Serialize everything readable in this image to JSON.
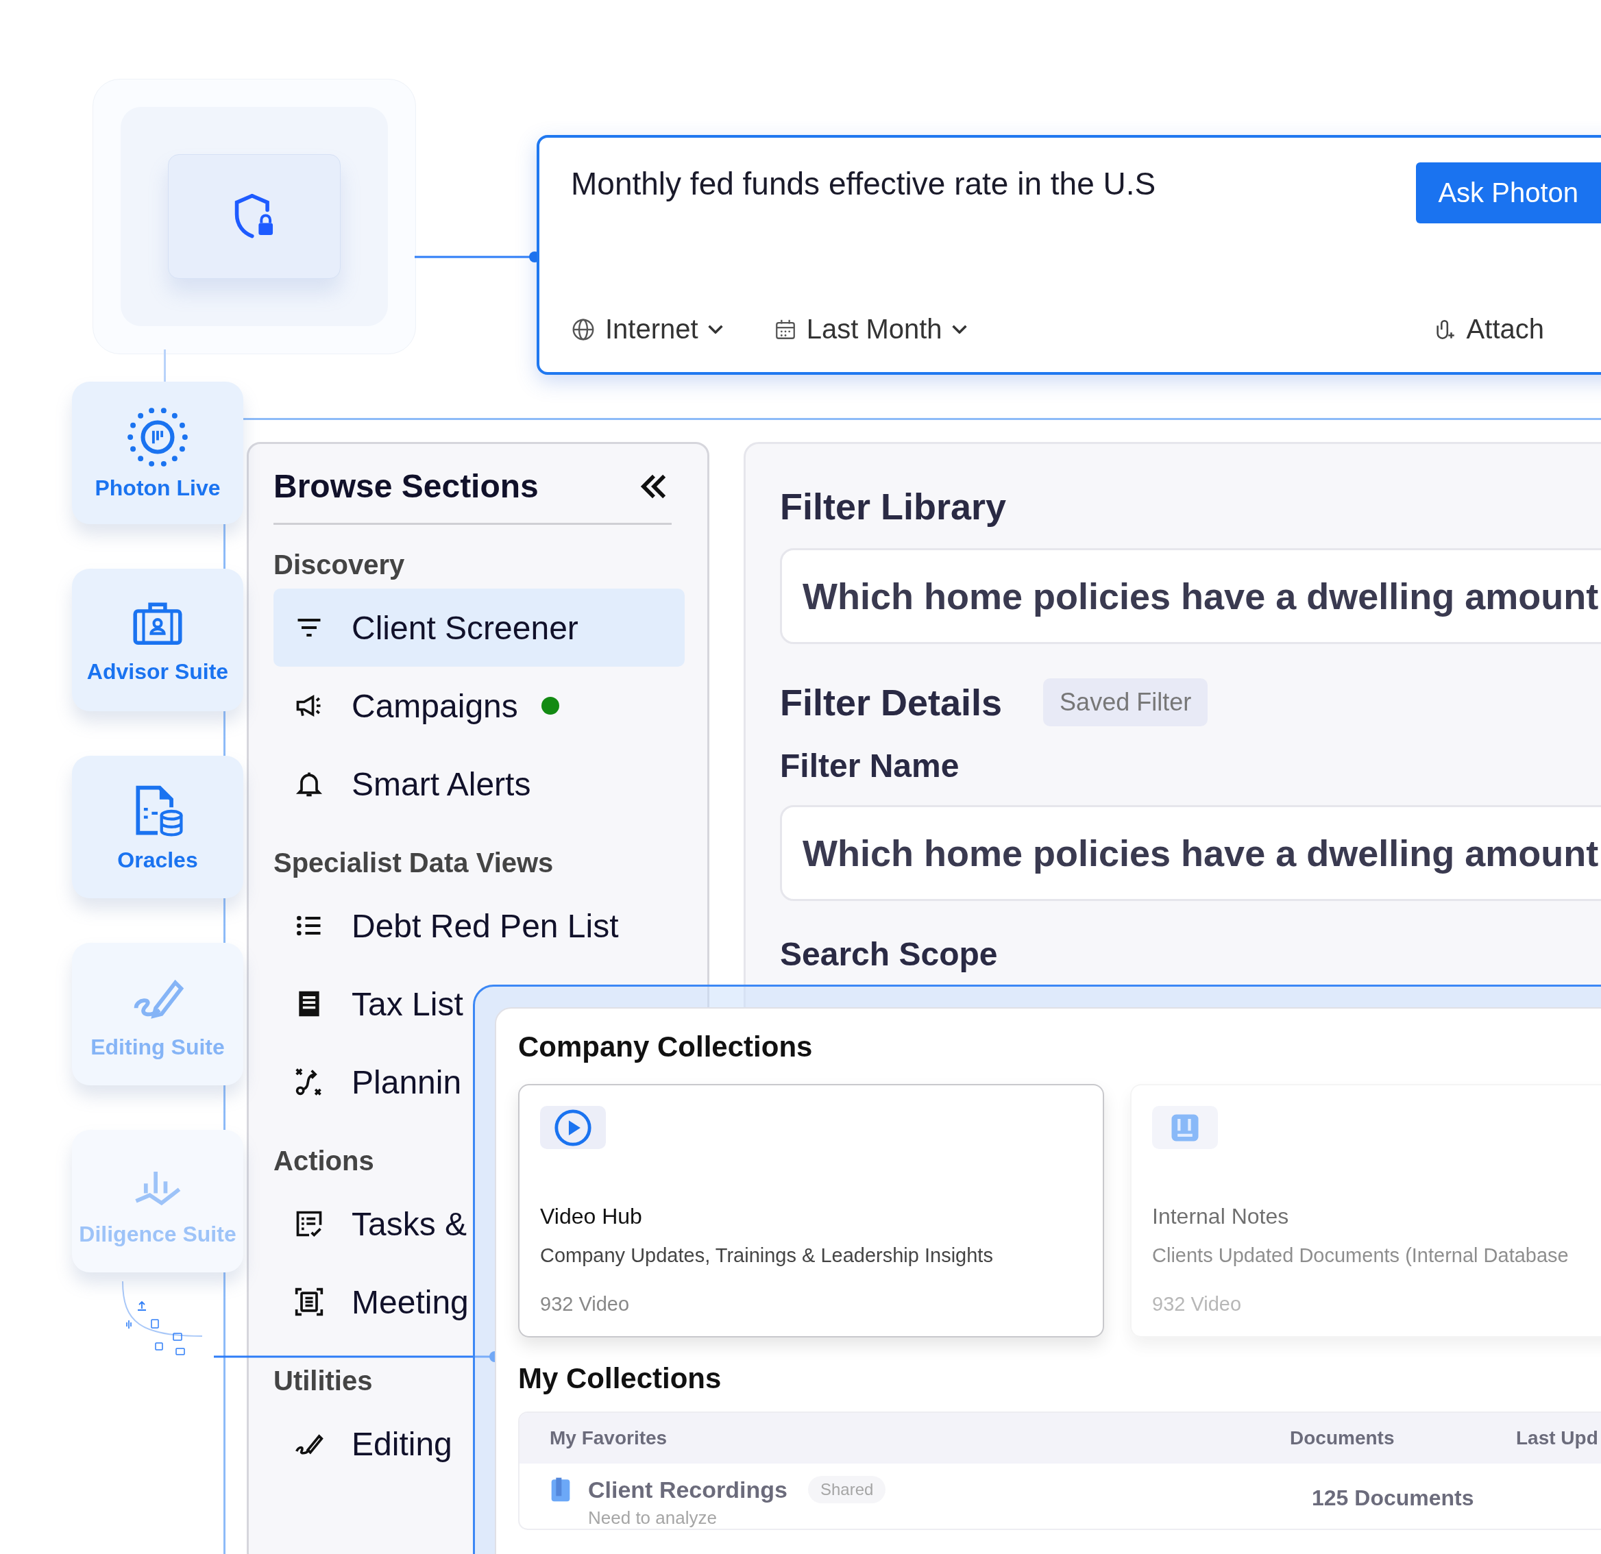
{
  "query_box": {
    "value": "Monthly fed funds effective rate in the U.S",
    "button": "Ask Photon",
    "filters": [
      {
        "kind": "globe",
        "label": "Internet"
      },
      {
        "kind": "calendar",
        "label": "Last Month"
      }
    ],
    "attach": "Attach"
  },
  "rail": {
    "items": [
      {
        "kind": "live",
        "label": "Photon Live"
      },
      {
        "kind": "briefcase",
        "label": "Advisor Suite"
      },
      {
        "kind": "database",
        "label": "Oracles"
      },
      {
        "kind": "pen",
        "label": "Editing Suite"
      },
      {
        "kind": "chart",
        "label": "Diligence Suite"
      }
    ]
  },
  "browse": {
    "title": "Browse Sections",
    "groups": [
      {
        "heading": "Discovery",
        "items": [
          {
            "kind": "filter",
            "label": "Client Screener",
            "selected": true
          },
          {
            "kind": "megaphone",
            "label": "Campaigns",
            "selected": false,
            "color": "#138a13"
          },
          {
            "kind": "bell",
            "label": "Smart Alerts",
            "selected": false
          }
        ]
      },
      {
        "heading": "Specialist Data Views",
        "items": [
          {
            "kind": "list",
            "label": "Debt Red Pen List",
            "selected": false
          },
          {
            "kind": "receipt",
            "label": "Tax List",
            "selected": false
          },
          {
            "kind": "route",
            "label": "Plannin",
            "selected": false
          }
        ]
      },
      {
        "heading": "Actions",
        "items": [
          {
            "kind": "tasks",
            "label": "Tasks &",
            "selected": false
          },
          {
            "kind": "meeting",
            "label": "Meeting",
            "selected": false
          }
        ]
      },
      {
        "heading": "Utilities",
        "items": [
          {
            "kind": "pen",
            "label": "Editing",
            "selected": false
          }
        ]
      }
    ]
  },
  "filter_panel": {
    "library_title": "Filter Library",
    "library_value": "Which home policies have a dwelling amount",
    "details_title": "Filter Details",
    "badge": "Saved Filter",
    "name_label": "Filter Name",
    "name_value": "Which home policies have a dwelling amount",
    "scope_label": "Search Scope"
  },
  "collections": {
    "title": "Company Collections",
    "cards": [
      {
        "kind": "video",
        "title": "Video Hub",
        "subtitle": "Company Updates, Trainings & Leadership Insights",
        "count": "932 Video",
        "blurred": false
      },
      {
        "kind": "notes",
        "title": "Internal Notes",
        "subtitle": "Clients Updated Documents (Internal Database",
        "count": "932 Video",
        "blurred": true
      }
    ],
    "my_title": "My Collections",
    "table": {
      "columns": [
        "My Favorites",
        "Documents",
        "Last Upd"
      ],
      "rows": [
        {
          "name": "Client Recordings",
          "tag": "Shared",
          "note": "Need to analyze",
          "documents": "125 Documents"
        }
      ]
    }
  }
}
